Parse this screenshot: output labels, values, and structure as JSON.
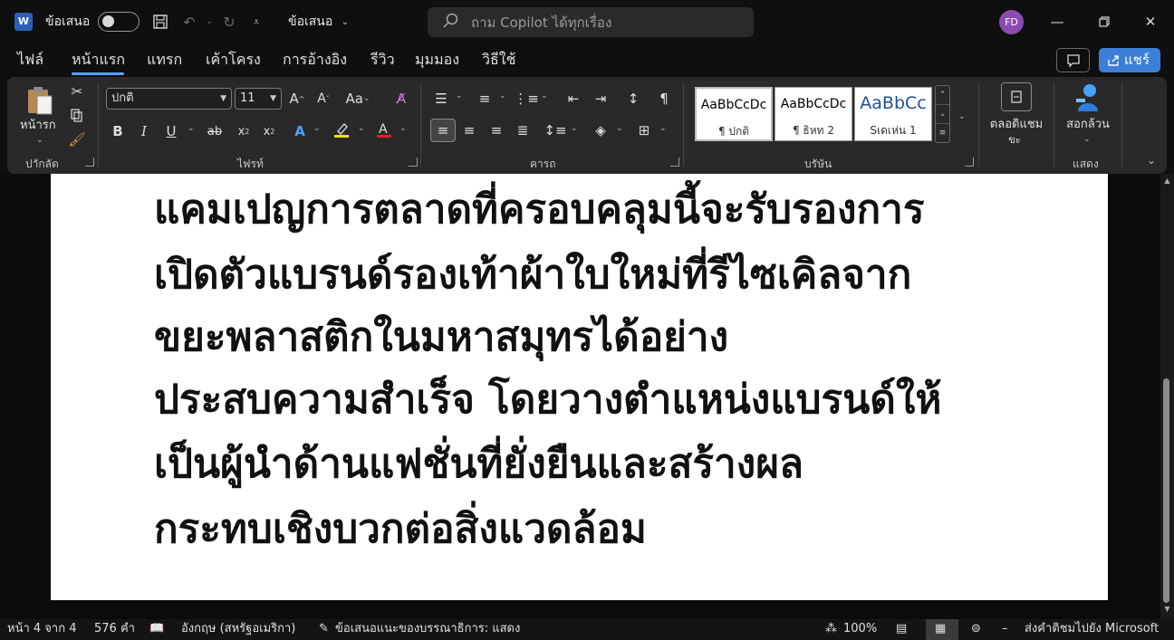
{
  "titlebar": {
    "app_icon_letter": "W",
    "autosave_label": "ข้อเสนอ",
    "doc_name": "ข้อเสนอ",
    "search_placeholder": "ถาม Copilot ได้ทุกเรื่อง",
    "avatar_initials": "FD"
  },
  "menu": {
    "tabs": [
      "ไฟล์",
      "หน้าแรก",
      "แทรก",
      "เค้าโครง",
      "การอ้างอิง",
      "รีวิว",
      "มุมมอง",
      "วิธีใช้"
    ],
    "active_tab": "หน้าแรก",
    "share_label": "แชร์"
  },
  "ribbon": {
    "clipboard": {
      "paste_label": "หน้ารก",
      "group_label": "ปาักลัด"
    },
    "font": {
      "font_name": "ปกติ",
      "font_size": "11",
      "group_label": "ไฟรท์",
      "case_label": "Aa"
    },
    "paragraph": {
      "group_label": "คารถ"
    },
    "styles": {
      "group_label": "บรัษัน",
      "items": [
        {
          "sample": "AaBbCcDc",
          "name": "¶ ปกติ"
        },
        {
          "sample": "AaBbCcDc",
          "name": "¶ ธิหท 2"
        },
        {
          "sample": "AaBbCc",
          "name": "Sเดเห่น 1"
        }
      ]
    },
    "dictate": {
      "label": "ตลอดิแชม",
      "label2": "ขะ"
    },
    "addins": {
      "label": "สอกล้วน",
      "group_label": "แสดง"
    }
  },
  "document": {
    "lines": [
      "แคมเปญการตลาดที่ครอบคลุมนี้จะรับรองการ",
      "เปิดตัวแบรนด์รองเท้าผ้าใบใหม่ที่รีไซเคิลจาก",
      "ขยะพลาสติกในมหาสมุทรได้อย่าง",
      "ประสบความสำเร็จ โดยวางตำแหน่งแบรนด์ให้",
      "เป็นผู้นำด้านแฟชั่นที่ยั่งยืนและสร้างผล",
      "กระทบเชิงบวกต่อสิ่งแวดล้อม"
    ]
  },
  "status": {
    "page": "หน้า 4 จาก 4",
    "words": "576 คำ",
    "language": "อังกฤษ (สหรัฐอเมริกา)",
    "editor": "ข้อเสนอแนะของบรรณาธิการ: แสดง",
    "zoom": "100%",
    "feedback": "ส่งคำติชมไปยัง Microsoft"
  },
  "colors": {
    "accent": "#3b7fd8",
    "background": "#0f0f0f",
    "ribbon": "#292929",
    "avatar": "#8b4bb2"
  }
}
